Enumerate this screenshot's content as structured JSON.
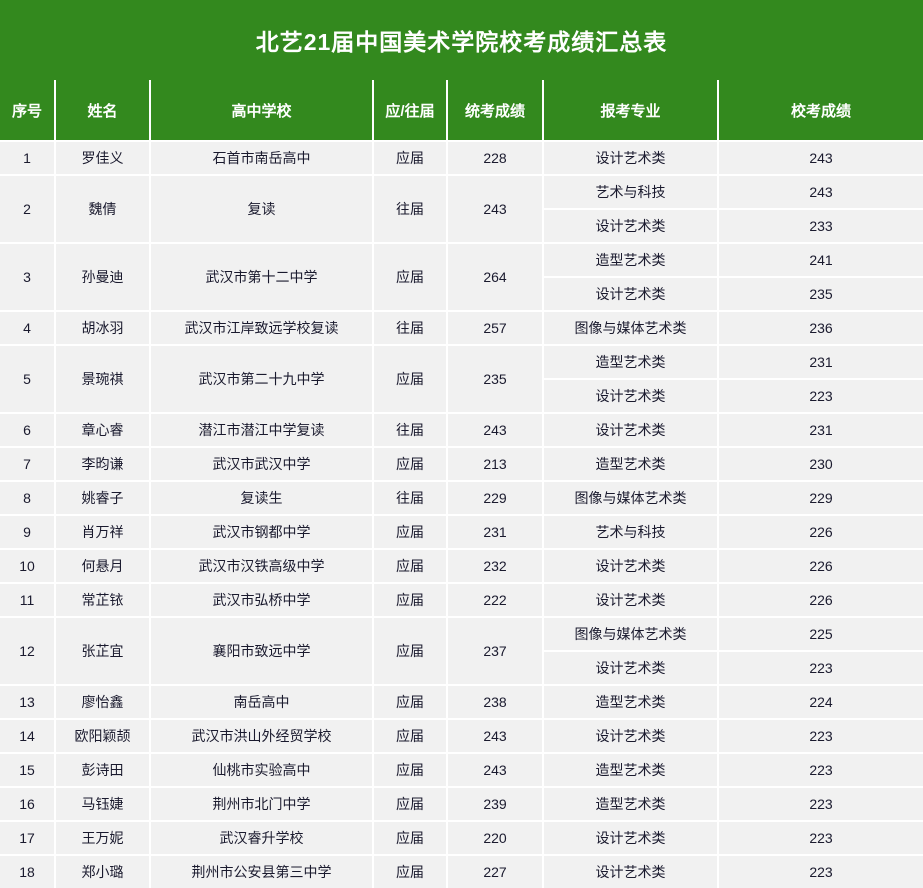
{
  "title": "北艺21届中国美术学院校考成绩汇总表",
  "theme": {
    "header_green": "#33891e",
    "row_gray": "#f1f1f1",
    "grid_white": "#ffffff",
    "text_dark": "#1a1a2e"
  },
  "columns": [
    {
      "key": "seq",
      "label": "序号"
    },
    {
      "key": "name",
      "label": "姓名"
    },
    {
      "key": "school",
      "label": "高中学校"
    },
    {
      "key": "type",
      "label": "应/往届"
    },
    {
      "key": "unified",
      "label": "统考成绩"
    },
    {
      "key": "major",
      "label": "报考专业"
    },
    {
      "key": "exam",
      "label": "校考成绩"
    }
  ],
  "rows": [
    {
      "seq": "1",
      "name": "罗佳义",
      "school": "石首市南岳高中",
      "type": "应届",
      "unified": "228",
      "entries": [
        {
          "major": "设计艺术类",
          "exam": "243"
        }
      ]
    },
    {
      "seq": "2",
      "name": "魏倩",
      "school": "复读",
      "type": "往届",
      "unified": "243",
      "entries": [
        {
          "major": "艺术与科技",
          "exam": "243"
        },
        {
          "major": "设计艺术类",
          "exam": "233"
        }
      ]
    },
    {
      "seq": "3",
      "name": "孙曼迪",
      "school": "武汉市第十二中学",
      "type": "应届",
      "unified": "264",
      "entries": [
        {
          "major": "造型艺术类",
          "exam": "241"
        },
        {
          "major": "设计艺术类",
          "exam": "235"
        }
      ]
    },
    {
      "seq": "4",
      "name": "胡冰羽",
      "school": "武汉市江岸致远学校复读",
      "type": "往届",
      "unified": "257",
      "entries": [
        {
          "major": "图像与媒体艺术类",
          "exam": "236"
        }
      ]
    },
    {
      "seq": "5",
      "name": "景琬祺",
      "school": "武汉市第二十九中学",
      "type": "应届",
      "unified": "235",
      "entries": [
        {
          "major": "造型艺术类",
          "exam": "231"
        },
        {
          "major": "设计艺术类",
          "exam": "223"
        }
      ]
    },
    {
      "seq": "6",
      "name": "章心睿",
      "school": "潜江市潜江中学复读",
      "type": "往届",
      "unified": "243",
      "entries": [
        {
          "major": "设计艺术类",
          "exam": "231"
        }
      ]
    },
    {
      "seq": "7",
      "name": "李昀谦",
      "school": "武汉市武汉中学",
      "type": "应届",
      "unified": "213",
      "entries": [
        {
          "major": "造型艺术类",
          "exam": "230"
        }
      ]
    },
    {
      "seq": "8",
      "name": "姚睿子",
      "school": "复读生",
      "type": "往届",
      "unified": "229",
      "entries": [
        {
          "major": "图像与媒体艺术类",
          "exam": "229"
        }
      ]
    },
    {
      "seq": "9",
      "name": "肖万祥",
      "school": "武汉市钢都中学",
      "type": "应届",
      "unified": "231",
      "entries": [
        {
          "major": "艺术与科技",
          "exam": "226"
        }
      ]
    },
    {
      "seq": "10",
      "name": "何悬月",
      "school": "武汉市汉铁高级中学",
      "type": "应届",
      "unified": "232",
      "entries": [
        {
          "major": "设计艺术类",
          "exam": "226"
        }
      ]
    },
    {
      "seq": "11",
      "name": "常芷铱",
      "school": "武汉市弘桥中学",
      "type": "应届",
      "unified": "222",
      "entries": [
        {
          "major": "设计艺术类",
          "exam": "226"
        }
      ]
    },
    {
      "seq": "12",
      "name": "张芷宜",
      "school": "襄阳市致远中学",
      "type": "应届",
      "unified": "237",
      "entries": [
        {
          "major": "图像与媒体艺术类",
          "exam": "225"
        },
        {
          "major": "设计艺术类",
          "exam": "223"
        }
      ]
    },
    {
      "seq": "13",
      "name": "廖怡鑫",
      "school": "南岳高中",
      "type": "应届",
      "unified": "238",
      "entries": [
        {
          "major": "造型艺术类",
          "exam": "224"
        }
      ]
    },
    {
      "seq": "14",
      "name": "欧阳颖颉",
      "school": "武汉市洪山外经贸学校",
      "type": "应届",
      "unified": "243",
      "entries": [
        {
          "major": "设计艺术类",
          "exam": "223"
        }
      ]
    },
    {
      "seq": "15",
      "name": "彭诗田",
      "school": "仙桃市实验高中",
      "type": "应届",
      "unified": "243",
      "entries": [
        {
          "major": "造型艺术类",
          "exam": "223"
        }
      ]
    },
    {
      "seq": "16",
      "name": "马钰婕",
      "school": "荆州市北门中学",
      "type": "应届",
      "unified": "239",
      "entries": [
        {
          "major": "造型艺术类",
          "exam": "223"
        }
      ]
    },
    {
      "seq": "17",
      "name": "王万妮",
      "school": "武汉睿升学校",
      "type": "应届",
      "unified": "220",
      "entries": [
        {
          "major": "设计艺术类",
          "exam": "223"
        }
      ]
    },
    {
      "seq": "18",
      "name": "郑小璐",
      "school": "荆州市公安县第三中学",
      "type": "应届",
      "unified": "227",
      "entries": [
        {
          "major": "设计艺术类",
          "exam": "223"
        }
      ]
    }
  ]
}
